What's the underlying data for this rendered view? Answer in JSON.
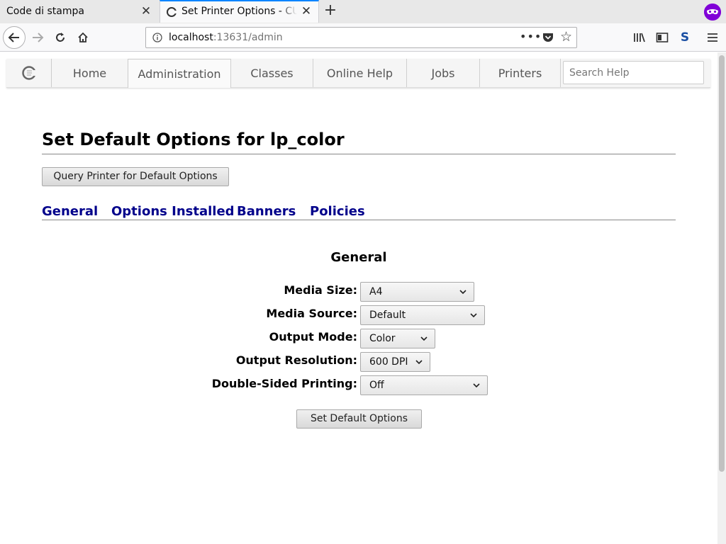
{
  "browser": {
    "tabs": [
      {
        "title": "Code di stampa",
        "active": false
      },
      {
        "title": "Set Printer Options - CUPS",
        "active": true
      }
    ],
    "url_host": "localhost",
    "url_rest": ":13631/admin",
    "url_more": "•••"
  },
  "cups_nav": {
    "items": [
      "Home",
      "Administration",
      "Classes",
      "Online Help",
      "Jobs",
      "Printers"
    ],
    "active": "Administration",
    "search_placeholder": "Search Help"
  },
  "page": {
    "title": "Set Default Options for lp_color",
    "query_button": "Query Printer for Default Options",
    "section_tabs": [
      "General",
      "Options Installed",
      "Banners",
      "Policies"
    ],
    "section_heading": "General",
    "options": [
      {
        "label": "Media Size:",
        "value": "A4"
      },
      {
        "label": "Media Source:",
        "value": "Default"
      },
      {
        "label": "Output Mode:",
        "value": "Color"
      },
      {
        "label": "Output Resolution:",
        "value": "600 DPI"
      },
      {
        "label": "Double-Sided Printing:",
        "value": "Off"
      }
    ],
    "submit_button": "Set Default Options"
  },
  "colors": {
    "link": "#00008b",
    "accent_tab": "#0a84ff",
    "private_badge": "#8000d7"
  }
}
